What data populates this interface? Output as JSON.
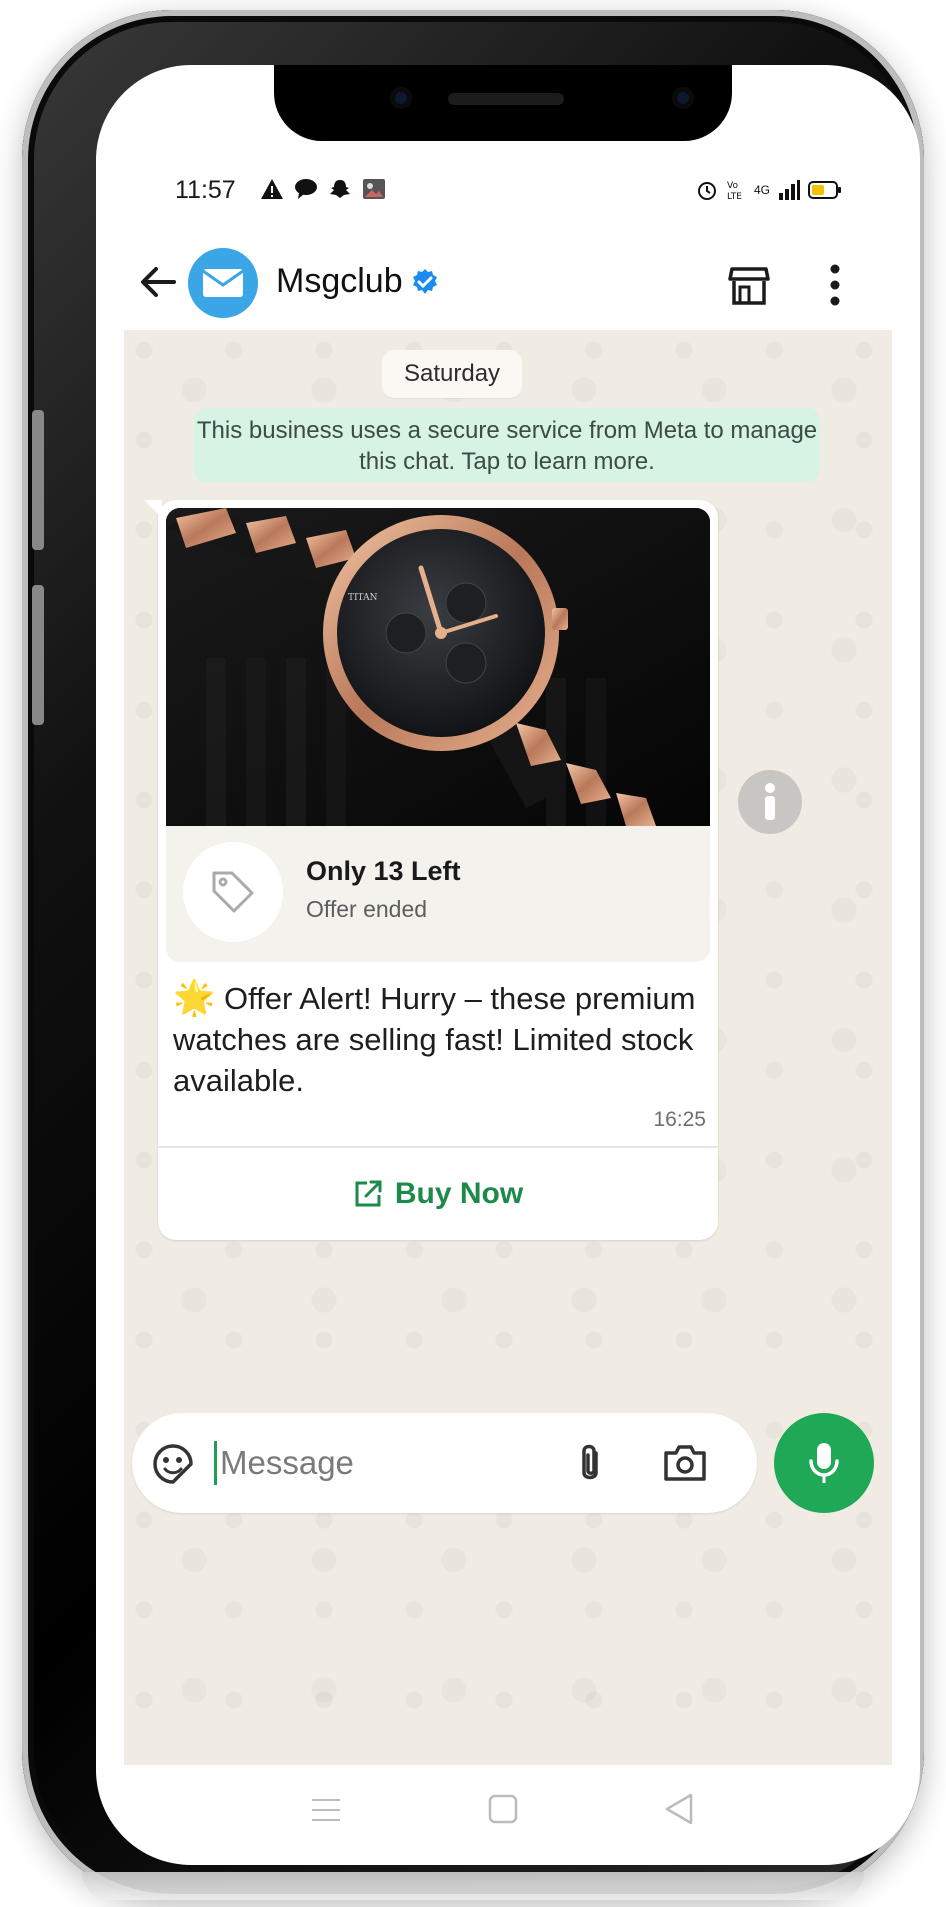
{
  "status_bar": {
    "time": "11:57",
    "network": "4G"
  },
  "header": {
    "title": "Msgclub"
  },
  "chat": {
    "date_label": "Saturday",
    "notice": "This business uses a secure service from Meta to manage this chat. Tap to learn more.",
    "message": {
      "offer_title": "Only 13 Left",
      "offer_subtitle": "Offer ended",
      "text": "Offer Alert! Hurry – these premium watches are selling fast! Limited stock available.",
      "emoji": "🌟",
      "time": "16:25",
      "button_label": "Buy Now"
    }
  },
  "composer": {
    "placeholder": "Message"
  },
  "colors": {
    "accent_green": "#1fa855",
    "cta_green": "#1e8a4a",
    "notice_bg": "#d7f3e4",
    "chat_bg": "#f1ece3",
    "avatar_blue": "#3aa6e6"
  }
}
